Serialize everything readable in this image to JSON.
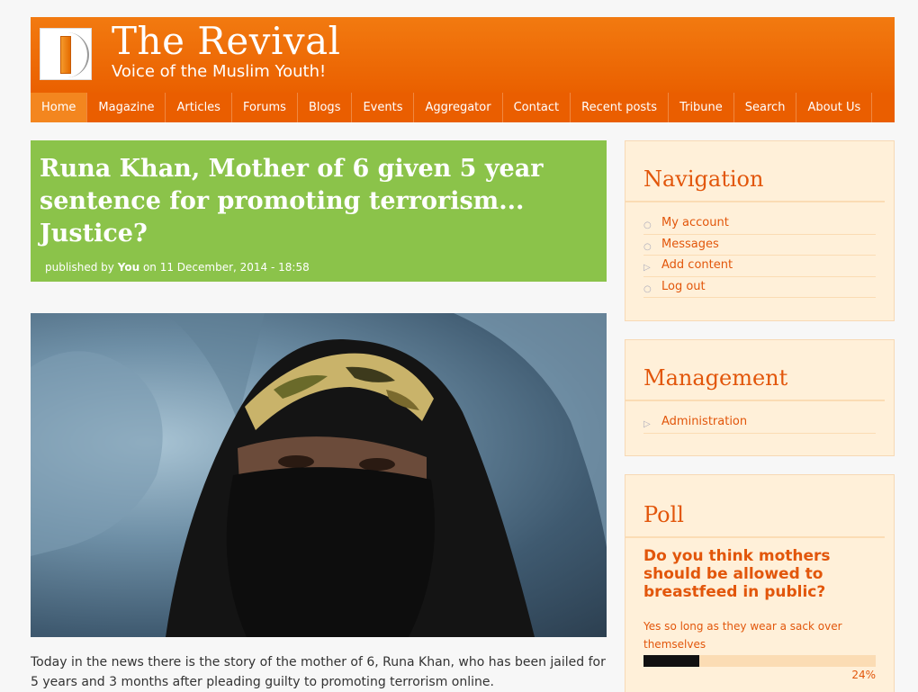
{
  "site": {
    "name": "The Revival",
    "slogan": "Voice of the Muslim Youth!"
  },
  "nav": [
    "Home",
    "Magazine",
    "Articles",
    "Forums",
    "Blogs",
    "Events",
    "Aggregator",
    "Contact",
    "Recent posts",
    "Tribune",
    "Search",
    "About Us"
  ],
  "article": {
    "title": "Runa Khan, Mother of 6 given 5 year sentence for promoting terrorism... Justice?",
    "published_by": "published by",
    "author": "You",
    "date": "on 11 December, 2014 - 18:58",
    "body": "Today in the news there is the story of the mother of 6, Runa Khan, who has been  jailed for 5 years and 3 months after pleading guilty to promoting terrorism online."
  },
  "navigation_block": {
    "title": "Navigation",
    "items": [
      "My account",
      "Messages",
      "Add content",
      "Log out"
    ]
  },
  "management_block": {
    "title": "Management",
    "items": [
      "Administration"
    ]
  },
  "poll": {
    "title": "Poll",
    "question": "Do you think mothers should be allowed to breastfeed in public?",
    "choice": "Yes so long as they wear a sack over themselves",
    "percent_label": "24%",
    "percent": 24
  },
  "colors": {
    "accent": "#ea6000",
    "title_bg": "#8bc34a",
    "sidebar_bg": "#fff0d9",
    "link": "#e2560b"
  }
}
